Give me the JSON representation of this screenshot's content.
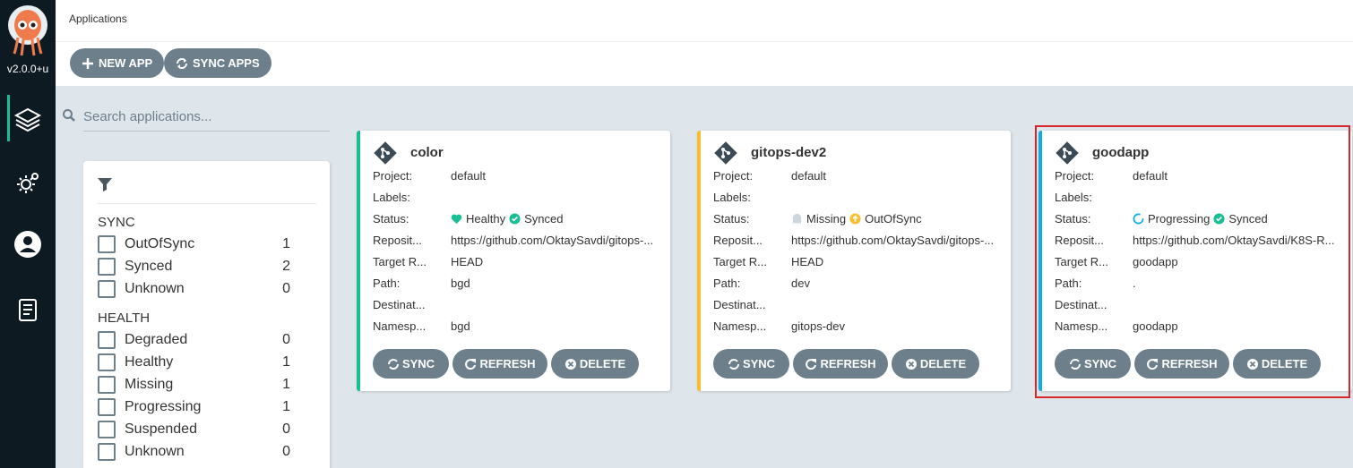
{
  "app": {
    "version": "v2.0.0+u"
  },
  "topbar": {
    "title": "Applications",
    "new_app": "NEW APP",
    "sync_apps": "SYNC APPS"
  },
  "search": {
    "placeholder": "Search applications..."
  },
  "filter": {
    "sync_title": "SYNC",
    "sync": [
      {
        "label": "OutOfSync",
        "count": "1"
      },
      {
        "label": "Synced",
        "count": "2"
      },
      {
        "label": "Unknown",
        "count": "0"
      }
    ],
    "health_title": "HEALTH",
    "health": [
      {
        "label": "Degraded",
        "count": "0"
      },
      {
        "label": "Healthy",
        "count": "1"
      },
      {
        "label": "Missing",
        "count": "1"
      },
      {
        "label": "Progressing",
        "count": "1"
      },
      {
        "label": "Suspended",
        "count": "0"
      },
      {
        "label": "Unknown",
        "count": "0"
      }
    ]
  },
  "labels": {
    "project": "Project:",
    "labels": "Labels:",
    "status": "Status:",
    "repo": "Reposit...",
    "target": "Target R...",
    "path": "Path:",
    "destination": "Destinat...",
    "namespace": "Namesp..."
  },
  "buttons": {
    "sync": "SYNC",
    "refresh": "REFRESH",
    "delete": "DELETE"
  },
  "cards": [
    {
      "name": "color",
      "project": "default",
      "labels": "",
      "health": "Healthy",
      "sync": "Synced",
      "repo": "https://github.com/OktaySavdi/gitops-...",
      "target": "HEAD",
      "path": "bgd",
      "destination": "",
      "namespace": "bgd",
      "accent": "#18be94"
    },
    {
      "name": "gitops-dev2",
      "project": "default",
      "labels": "",
      "health": "Missing",
      "sync": "OutOfSync",
      "repo": "https://github.com/OktaySavdi/gitops-...",
      "target": "HEAD",
      "path": "dev",
      "destination": "",
      "namespace": "gitops-dev",
      "accent": "#f4c030"
    },
    {
      "name": "goodapp",
      "project": "default",
      "labels": "",
      "health": "Progressing",
      "sync": "Synced",
      "repo": "https://github.com/OktaySavdi/K8S-R...",
      "target": "goodapp",
      "path": ".",
      "destination": "",
      "namespace": "goodapp",
      "accent": "#0dadea"
    }
  ],
  "colors": {
    "healthy": "#18be94",
    "synced": "#18be94",
    "missing": "#ccd6dd",
    "outofsync": "#f4c030",
    "progressing": "#0dadea",
    "highlight": "#d9262a"
  }
}
